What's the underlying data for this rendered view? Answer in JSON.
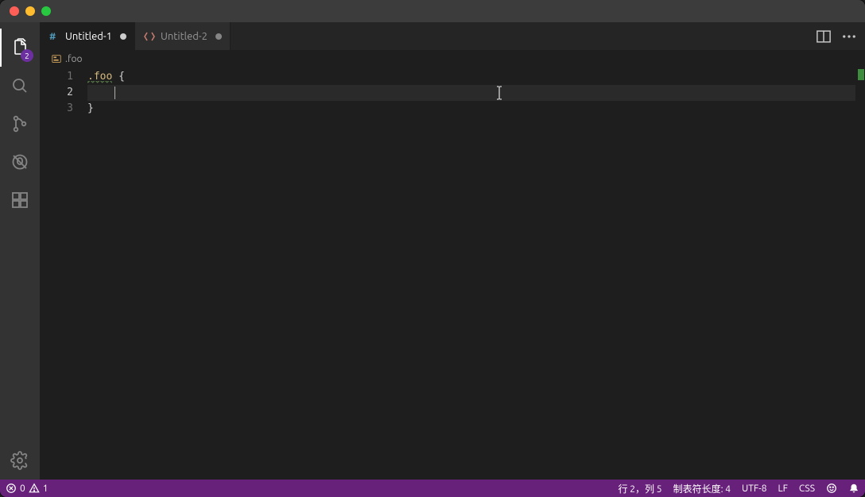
{
  "activitybar": {
    "explorer_badge": "2"
  },
  "tabs": [
    {
      "label": "Untitled-1",
      "type": "css",
      "active": true,
      "dirty": true
    },
    {
      "label": "Untitled-2",
      "type": "html",
      "active": false,
      "dirty": true
    }
  ],
  "breadcrumb": {
    "item1": ".foo"
  },
  "editor": {
    "line_numbers": [
      "1",
      "2",
      "3"
    ],
    "active_line_index": 1,
    "code": {
      "l1_selector": ".foo",
      "l1_after": " {",
      "l3_brace": "}"
    }
  },
  "statusbar": {
    "errors": "0",
    "warnings": "1",
    "cursor": "行 2，列 5",
    "tabsize": "制表符长度: 4",
    "encoding": "UTF-8",
    "eol": "LF",
    "lang": "CSS"
  }
}
